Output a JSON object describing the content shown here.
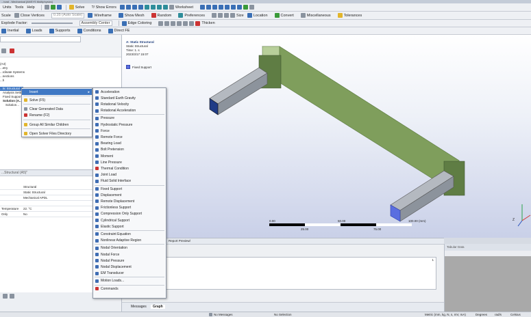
{
  "title_bar": "...tural - Mechanical [ANSYS Multiphysics]",
  "toolbar1": {
    "menus": [
      "Units",
      "Tools",
      "Help"
    ],
    "solve": "Solve",
    "show_errors": "?/ Show Errors",
    "worksheet": "Worksheet"
  },
  "toolbar2": {
    "scale": "Scale",
    "close_vertices": "Close Vertices",
    "auto_scale": "0.35 (Auto Scale)",
    "wireframe": "Wireframe",
    "show_mesh": "Show Mesh",
    "random": "Random",
    "preferences": "Preferences",
    "size": "Size",
    "location": "Location",
    "convert": "Convert",
    "miscellaneous": "Miscellaneous",
    "tolerances": "Tolerances"
  },
  "toolbar3": {
    "explode_factor": "Explode Factor:",
    "assembly_center": "Assembly Center",
    "edge_coloring": "Edge Coloring",
    "thicken": "Thicken"
  },
  "toolbar4": {
    "items": [
      "Inertial",
      "Loads",
      "Supports",
      "Conditions",
      "Direct FE"
    ]
  },
  "outline": {
    "tree": [
      "(A4)",
      "...etry",
      "...rdinate Systems",
      "...nections",
      "...h",
      "...tic Structural",
      "Analysis Setti...",
      "Fixed Support",
      "Solution (A...",
      "Solution..."
    ]
  },
  "context_menu": {
    "items": [
      {
        "label": "Insert",
        "highlighted": true
      },
      {
        "label": "Solve (F5)"
      },
      {
        "label": "Clear Generated Data"
      },
      {
        "label": "Rename (F2)"
      },
      {
        "label": "Group All Similar Children"
      },
      {
        "label": "Open Solver Files Directory"
      }
    ]
  },
  "insert_submenu": {
    "items": [
      "Acceleration",
      "Standard Earth Gravity",
      "Rotational Velocity",
      "Rotational Acceleration",
      "Pressure",
      "Hydrostatic Pressure",
      "Force",
      "Remote Force",
      "Bearing Load",
      "Bolt Pretension",
      "Moment",
      "Line Pressure",
      "Thermal Condition",
      "Joint Load",
      "Fluid Solid Interface",
      "Fixed Support",
      "Displacement",
      "Remote Displacement",
      "Frictionless Support",
      "Compression Only Support",
      "Cylindrical Support",
      "Elastic Support",
      "Constraint Equation",
      "Nonlinear Adaptive Region",
      "Nodal Orientation",
      "Nodal Force",
      "Nodal Pressure",
      "Nodal Displacement",
      "EM Transducer",
      "Motion Loads...",
      "Commands"
    ]
  },
  "details": {
    "header": "...Structural (A5)\"",
    "rows": [
      {
        "key": "",
        "value": "Structural"
      },
      {
        "key": "",
        "value": "Static Structural"
      },
      {
        "key": "",
        "value": "Mechanical APDL"
      },
      {
        "key": "",
        "value": ""
      },
      {
        "key": "Temperature",
        "value": "22. °C"
      },
      {
        "key": "Only",
        "value": "No"
      }
    ]
  },
  "viewport": {
    "title": "A: Static Structural",
    "subtitle": "Static Structural",
    "time": "Time: 1. s",
    "date": "2023/3/17 15:07",
    "legend_label": "Fixed Support",
    "scale_top": [
      "0.00",
      "50.00",
      "100.00 (mm)"
    ],
    "scale_bottom": [
      "25.00",
      "75.00"
    ],
    "axis_z": "Z"
  },
  "view_tabs": {
    "report_preview": "Report Preview/"
  },
  "graph": {
    "tick_one": "1"
  },
  "graph_tabs": [
    "Messages",
    "Graph"
  ],
  "tabular_data": {
    "title": "Tabular Data"
  },
  "status": {
    "messages": "No Messages",
    "selection": "No Selection",
    "units": "Metric (mm, kg, N, s, mV, mA)",
    "degrees": "Degrees",
    "rads": "rad/s",
    "celsius": "Celsius"
  },
  "colors": {
    "beam_green": "#8fb06a",
    "beam_green_dark": "#5f7d44",
    "beam_gray": "#9aa0a8",
    "fixed_support": "#5a6ee0",
    "menu_highlight": "#3f78c4"
  }
}
